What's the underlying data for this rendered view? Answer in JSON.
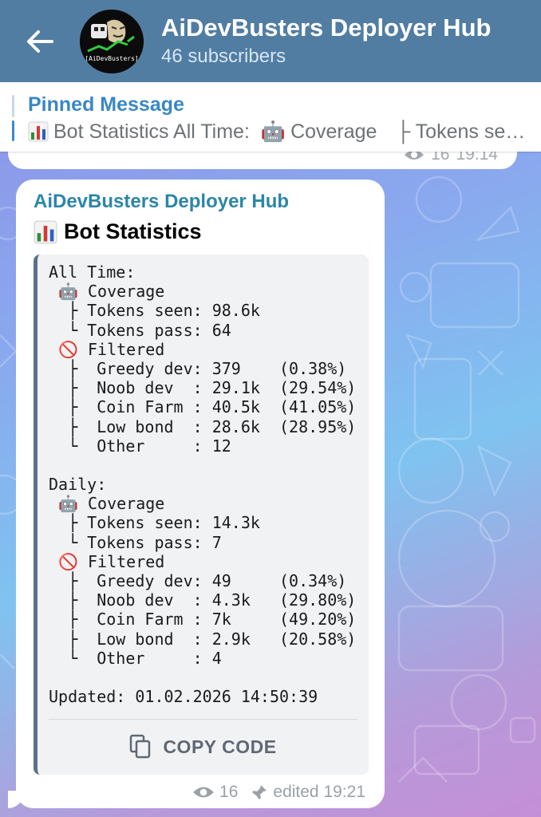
{
  "header": {
    "back_icon": "arrow-left-icon",
    "title": "AiDevBusters Deployer Hub",
    "subscribers": "46 subscribers",
    "avatar_text": "[AiDevBusters]"
  },
  "pinned": {
    "title": "Pinned Message",
    "text_prefix": "Bot Statistics All Time:",
    "text_coverage": "Coverage",
    "text_tail": "├ Tokens se…",
    "icon_chart": "bar-chart-icon",
    "icon_robot": "robot-icon"
  },
  "previous_message": {
    "views": "16",
    "time": "19:14"
  },
  "message": {
    "sender": "AiDevBusters Deployer Hub",
    "heading": "Bot Statistics",
    "code_lines": [
      "All Time:",
      " 🤖 Coverage",
      "  ├ Tokens seen: 98.6k",
      "  └ Tokens pass: 64",
      " 🚫 Filtered",
      "  ├  Greedy dev: 379    (0.38%)",
      "  ├  Noob dev  : 29.1k  (29.54%)",
      "  ├  Coin Farm : 40.5k  (41.05%)",
      "  ├  Low bond  : 28.6k  (28.95%)",
      "  └  Other     : 12",
      "",
      "Daily:",
      " 🤖 Coverage",
      "  ├ Tokens seen: 14.3k",
      "  └ Tokens pass: 7",
      " 🚫 Filtered",
      "  ├  Greedy dev: 49     (0.34%)",
      "  ├  Noob dev  : 4.3k   (29.80%)",
      "  ├  Coin Farm : 7k     (49.20%)",
      "  ├  Low bond  : 2.9k   (20.58%)",
      "  └  Other     : 4",
      "",
      "Updated: 01.02.2026 14:50:39"
    ],
    "copy_label": "COPY CODE",
    "views": "16",
    "edited_time": "edited 19:21"
  },
  "colors": {
    "header_bg": "#517da2",
    "accent_blue": "#3a87c4",
    "sender_teal": "#2c86a8",
    "code_bg": "#f1f2f4",
    "code_border": "#5a7288"
  }
}
